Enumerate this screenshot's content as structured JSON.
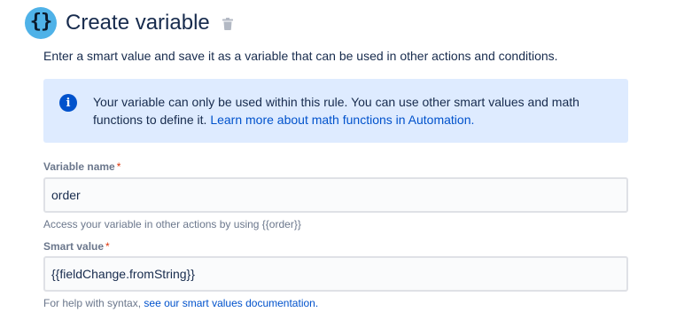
{
  "header": {
    "icon_glyph": "{}",
    "icon_name": "curly-braces-icon",
    "title": "Create variable",
    "delete_icon": "trash-icon"
  },
  "description": "Enter a smart value and save it as a variable that can be used in other actions and conditions.",
  "info_panel": {
    "icon_glyph": "i",
    "text": "Your variable can only be used within this rule. You can use other smart values and math functions to define it.",
    "link_text": "Learn more about math functions in Automation."
  },
  "variable_name": {
    "label": "Variable name",
    "required_marker": "*",
    "value": "order",
    "helper": "Access your variable in other actions by using {{order}}"
  },
  "smart_value": {
    "label": "Smart value",
    "required_marker": "*",
    "value": "{{fieldChange.fromString}}",
    "helper_prefix": "For help with syntax,",
    "helper_link": "see our smart values documentation."
  },
  "colors": {
    "icon_bg": "#4fb2e8",
    "info_bg": "#deebff",
    "info_icon": "#0052cc",
    "link": "#0052cc",
    "required": "#de350b"
  }
}
